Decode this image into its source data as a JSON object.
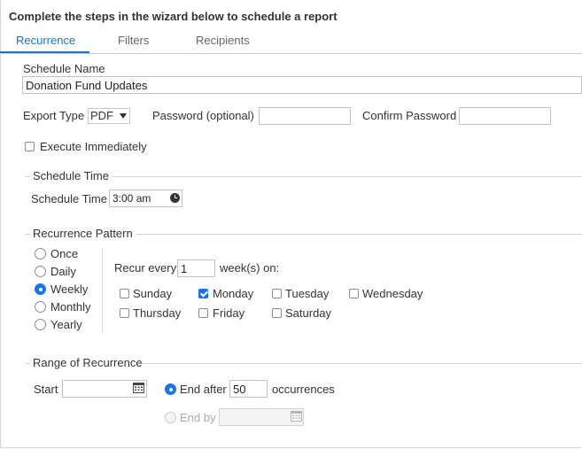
{
  "header": {
    "title": "Complete the steps in the wizard below to schedule a report"
  },
  "tabs": [
    {
      "label": "Recurrence",
      "active": true
    },
    {
      "label": "Filters",
      "active": false
    },
    {
      "label": "Recipients",
      "active": false
    }
  ],
  "schedule_name": {
    "label": "Schedule Name",
    "value": "Donation Fund Updates"
  },
  "export": {
    "label": "Export Type",
    "selected": "PDF"
  },
  "password": {
    "label": "Password (optional)",
    "value": ""
  },
  "confirm_password": {
    "label": "Confirm Password",
    "value": ""
  },
  "execute_immediately": {
    "label": "Execute Immediately",
    "checked": false
  },
  "schedule_time_section": {
    "legend": "Schedule Time",
    "label": "Schedule Time",
    "value": "3:00 am"
  },
  "recurrence_pattern": {
    "legend": "Recurrence Pattern",
    "options": [
      {
        "label": "Once",
        "checked": false
      },
      {
        "label": "Daily",
        "checked": false
      },
      {
        "label": "Weekly",
        "checked": true
      },
      {
        "label": "Monthly",
        "checked": false
      },
      {
        "label": "Yearly",
        "checked": false
      }
    ],
    "recur_every_label": "Recur every",
    "recur_every_value": "1",
    "weeks_on_label": "week(s) on:",
    "days": [
      {
        "label": "Sunday",
        "checked": false
      },
      {
        "label": "Monday",
        "checked": true
      },
      {
        "label": "Tuesday",
        "checked": false
      },
      {
        "label": "Wednesday",
        "checked": false
      },
      {
        "label": "Thursday",
        "checked": false
      },
      {
        "label": "Friday",
        "checked": false
      },
      {
        "label": "Saturday",
        "checked": false
      }
    ]
  },
  "range": {
    "legend": "Range of Recurrence",
    "start_label": "Start",
    "start_value": "",
    "end_after_label": "End after",
    "end_after_value": "50",
    "occurrences_label": "occurrences",
    "end_by_label": "End by",
    "end_by_value": ""
  },
  "colors": {
    "accent": "#1a73c9",
    "checked": "#1a73e8"
  }
}
